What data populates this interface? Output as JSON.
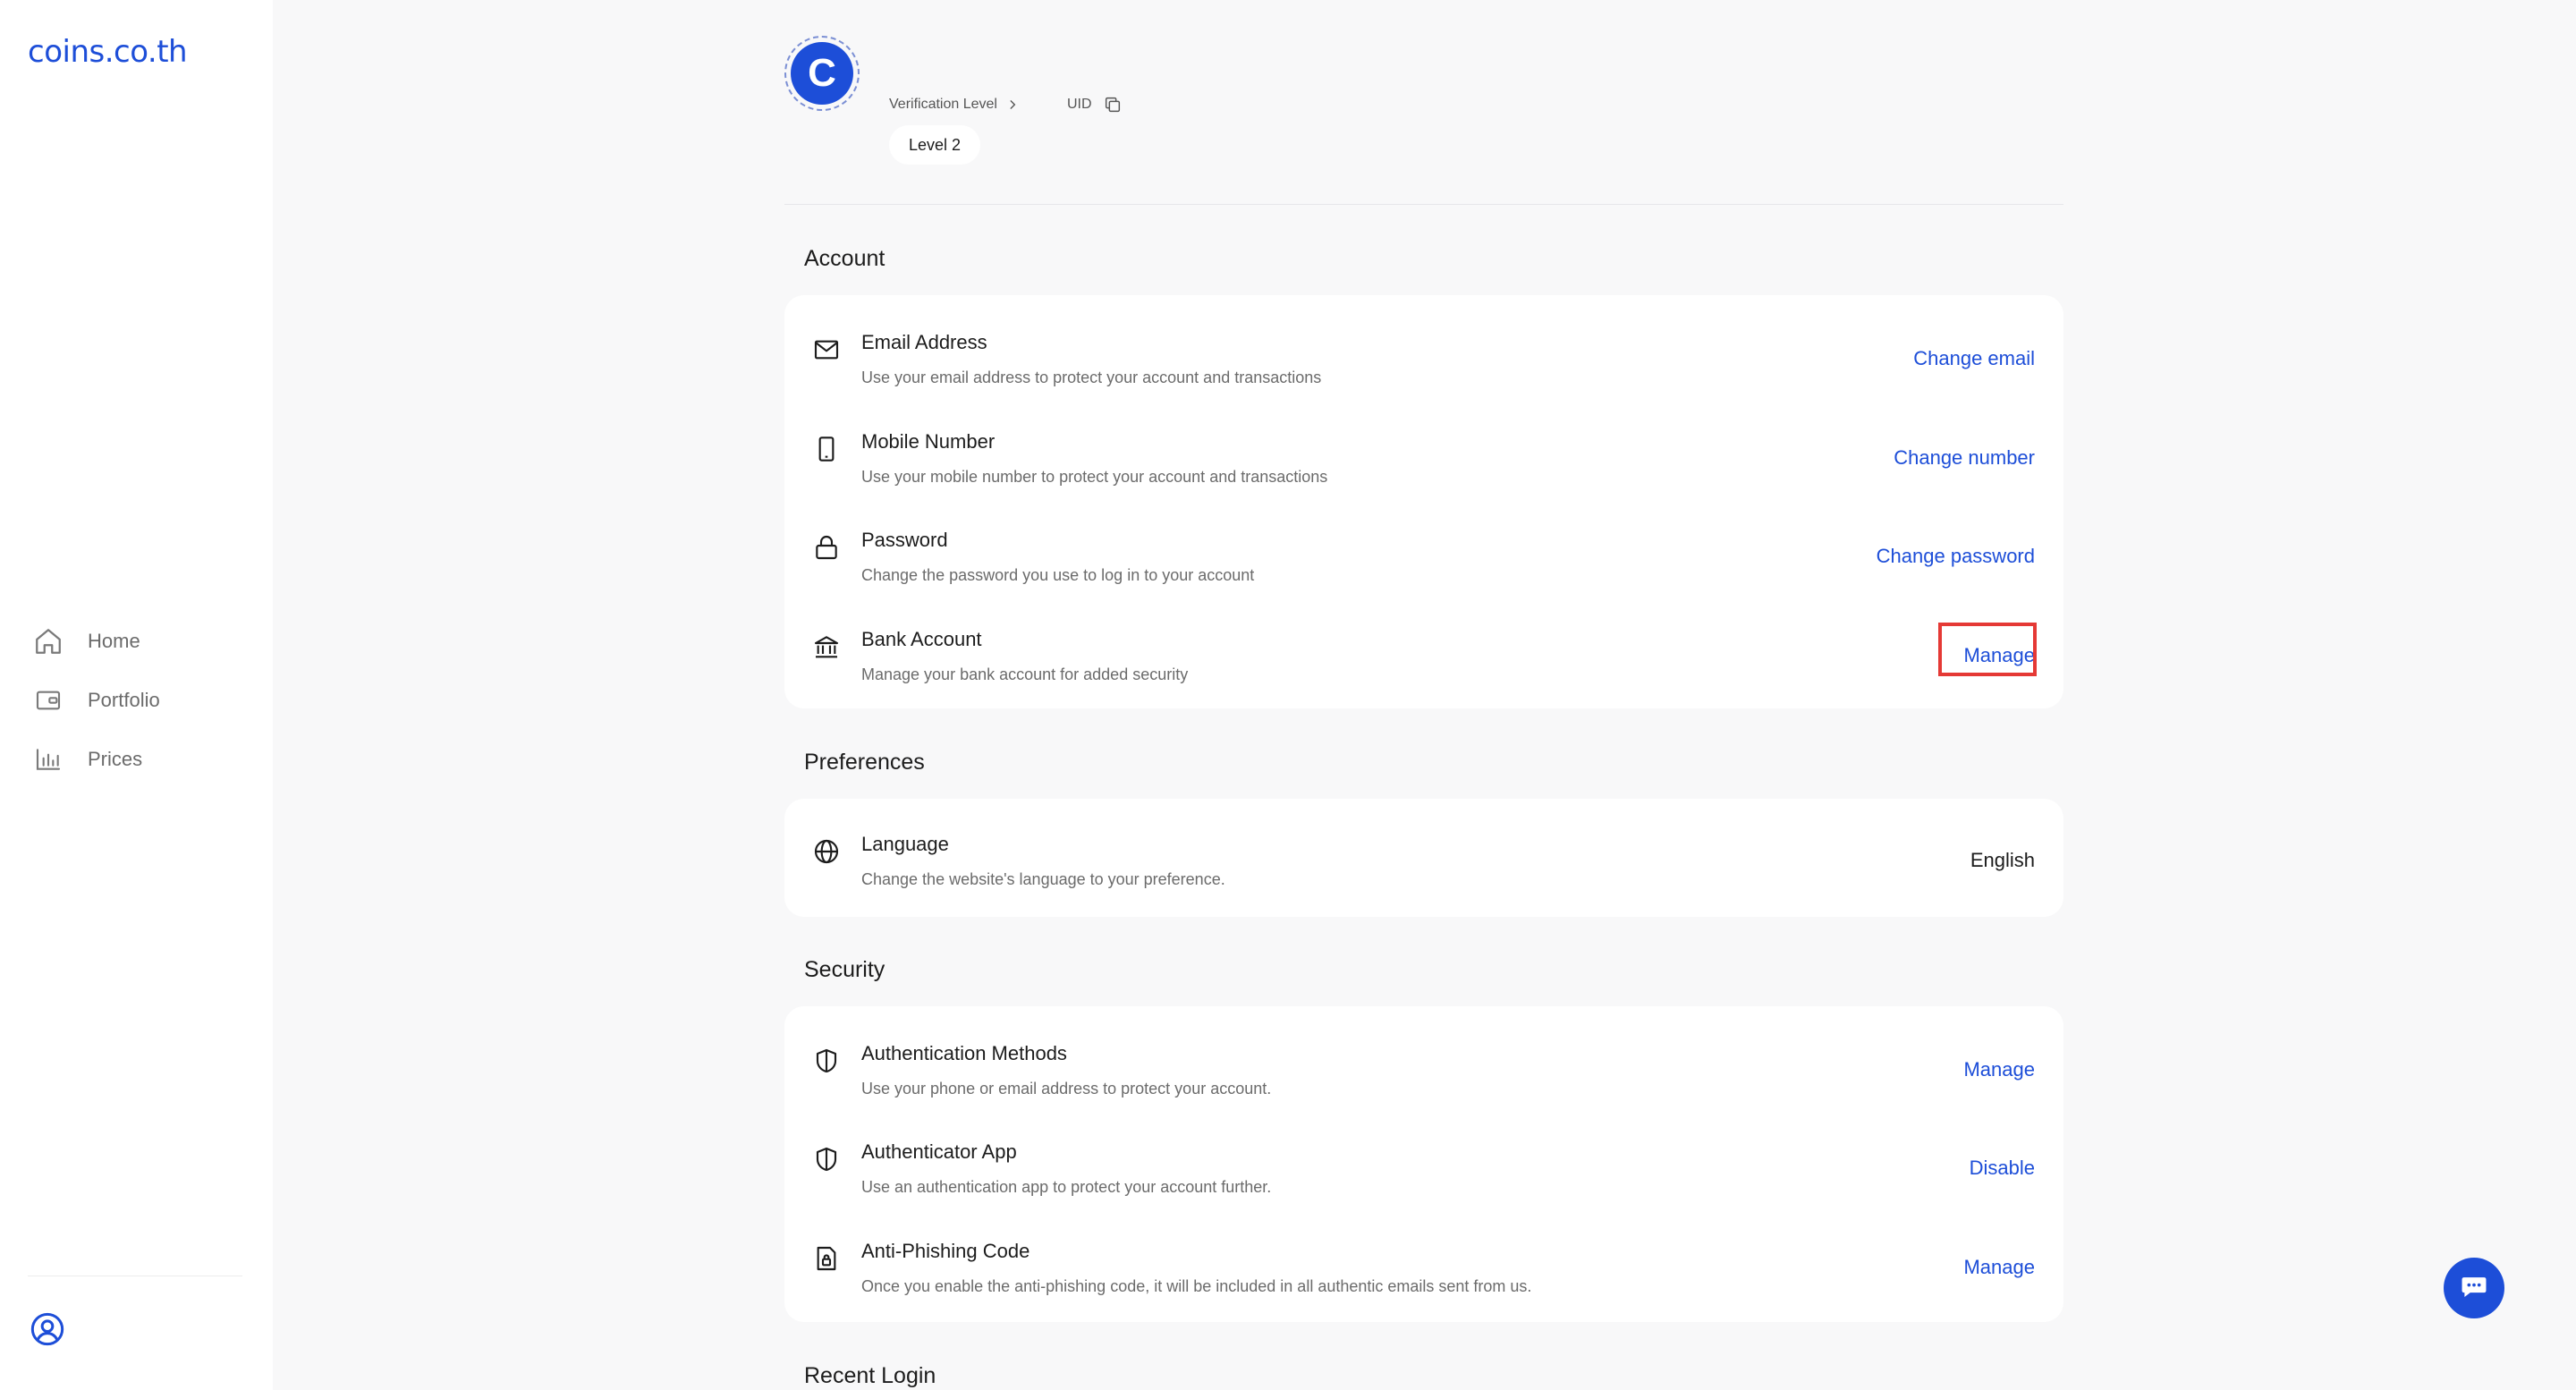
{
  "brand": {
    "logo_text": "coins.co.th",
    "accent": "#1d4ed8",
    "highlight": "#e53935"
  },
  "sidebar": {
    "items": [
      {
        "label": "Home",
        "icon": "home-icon"
      },
      {
        "label": "Portfolio",
        "icon": "wallet-icon"
      },
      {
        "label": "Prices",
        "icon": "chart-icon"
      }
    ],
    "profile_icon": "user-circle-icon"
  },
  "profile": {
    "avatar_letter": "C",
    "verification_label": "Verification Level",
    "uid_label": "UID",
    "level_value": "Level 2"
  },
  "sections": {
    "account": {
      "title": "Account",
      "rows": [
        {
          "icon": "mail-icon",
          "title": "Email Address",
          "desc": "Use your email address to protect your account and transactions",
          "action": "Change email"
        },
        {
          "icon": "phone-icon",
          "title": "Mobile Number",
          "desc": "Use your mobile number to protect your account and transactions",
          "action": "Change number"
        },
        {
          "icon": "lock-icon",
          "title": "Password",
          "desc": "Change the password you use to log in to your account",
          "action": "Change password"
        },
        {
          "icon": "bank-icon",
          "title": "Bank Account",
          "desc": "Manage your bank account for added security",
          "action": "Manage"
        }
      ]
    },
    "preferences": {
      "title": "Preferences",
      "rows": [
        {
          "icon": "globe-icon",
          "title": "Language",
          "desc": "Change the website's language to your preference.",
          "value": "English"
        }
      ]
    },
    "security": {
      "title": "Security",
      "rows": [
        {
          "icon": "shield-icon",
          "title": "Authentication Methods",
          "desc": "Use your phone or email address to protect your account.",
          "action": "Manage"
        },
        {
          "icon": "shield-icon",
          "title": "Authenticator App",
          "desc": "Use an authentication app to protect your account further.",
          "action": "Disable"
        },
        {
          "icon": "doc-lock-icon",
          "title": "Anti-Phishing Code",
          "desc": "Once you enable the anti-phishing code, it will be included in all authentic emails sent from us.",
          "action": "Manage"
        }
      ]
    },
    "recent_login": {
      "title": "Recent Login"
    }
  },
  "chat": {
    "icon": "chat-icon"
  }
}
